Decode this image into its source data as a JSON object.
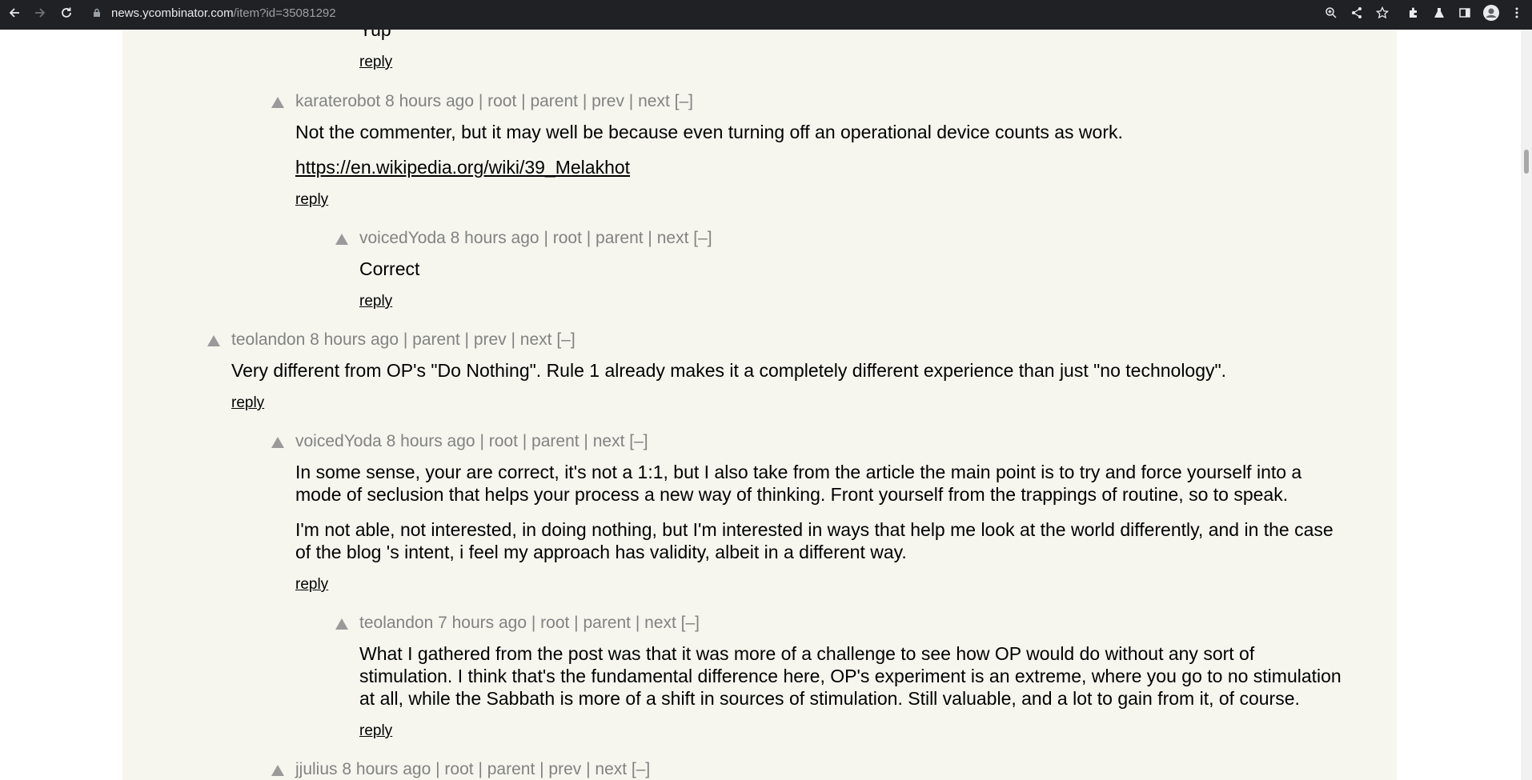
{
  "browser": {
    "url_host": "news.ycombinator.com",
    "url_path": "/item?id=35081292"
  },
  "comments": [
    {
      "text": "Yup",
      "reply": "reply"
    },
    {
      "user": "karaterobot",
      "age": "8 hours ago",
      "nav": "| root | parent | prev | next [–]",
      "text1": "Not the commenter, but it may well be because even turning off an operational device counts as work.",
      "link": "https://en.wikipedia.org/wiki/39_Melakhot",
      "reply": "reply"
    },
    {
      "user": "voicedYoda",
      "age": "8 hours ago",
      "nav": "| root | parent | next [–]",
      "text1": "Correct",
      "reply": "reply"
    },
    {
      "user": "teolandon",
      "age": "8 hours ago",
      "nav": "| parent | prev | next [–]",
      "text1": "Very different from OP's \"Do Nothing\". Rule 1 already makes it a completely different experience than just \"no technology\".",
      "reply": "reply"
    },
    {
      "user": "voicedYoda",
      "age": "8 hours ago",
      "nav": "| root | parent | next [–]",
      "text1a": "In some sense, your are correct, it's not a 1:1, but I also take from the article the main point is to try and force yourself into a",
      "text1b": "mode of seclusion that helps your process a new way of thinking. Front yourself from the trappings of routine, so to speak.",
      "text2a": "I'm not able, not interested, in doing nothing, but I'm interested in ways that help me look at the world differently, and in the case",
      "text2b": "of the blog 's intent, i feel my approach has validity, albeit in a different way.",
      "reply": "reply"
    },
    {
      "user": "teolandon",
      "age": "7 hours ago",
      "nav": "| root | parent | next [–]",
      "text1a": "What I gathered from the post was that it was more of a challenge to see how OP would do without any sort of",
      "text1b": "stimulation. I think that's the fundamental difference here, OP's experiment is an extreme, where you go to no stimulation",
      "text1c": "at all, while the Sabbath is more of a shift in sources of stimulation. Still valuable, and a lot to gain from it, of course.",
      "reply": "reply"
    },
    {
      "user": "jjulius",
      "age": "8 hours ago",
      "nav": "| root | parent | prev | next [–]"
    }
  ]
}
